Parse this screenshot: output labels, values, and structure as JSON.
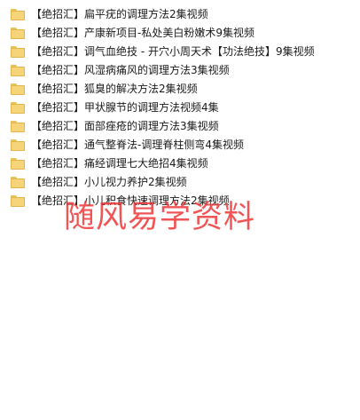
{
  "files": [
    {
      "icon": "folder-icon",
      "name": "【绝招汇】扁平疣的调理方法2集视频"
    },
    {
      "icon": "folder-icon",
      "name": "【绝招汇】产康新项目-私处美白粉嫩术9集视频"
    },
    {
      "icon": "folder-icon",
      "name": "【绝招汇】调气血绝技 - 开穴小周天术【功法绝技】9集视频"
    },
    {
      "icon": "folder-icon",
      "name": "【绝招汇】风湿病痛风的调理方法3集视频"
    },
    {
      "icon": "folder-icon",
      "name": "【绝招汇】狐臭的解决方法2集视频"
    },
    {
      "icon": "folder-icon",
      "name": "【绝招汇】甲状腺节的调理方法视频4集"
    },
    {
      "icon": "folder-icon",
      "name": "【绝招汇】面部痤疮的调理方法3集视频"
    },
    {
      "icon": "folder-icon",
      "name": "【绝招汇】通气整脊法-调理脊柱侧弯4集视频"
    },
    {
      "icon": "folder-icon",
      "name": "【绝招汇】痛经调理七大绝招4集视频"
    },
    {
      "icon": "folder-icon",
      "name": "【绝招汇】小儿视力养护2集视频"
    },
    {
      "icon": "folder-icon",
      "name": "【绝招汇】小儿积食快速调理方法2集视频"
    }
  ],
  "watermark": "随风易学资料"
}
